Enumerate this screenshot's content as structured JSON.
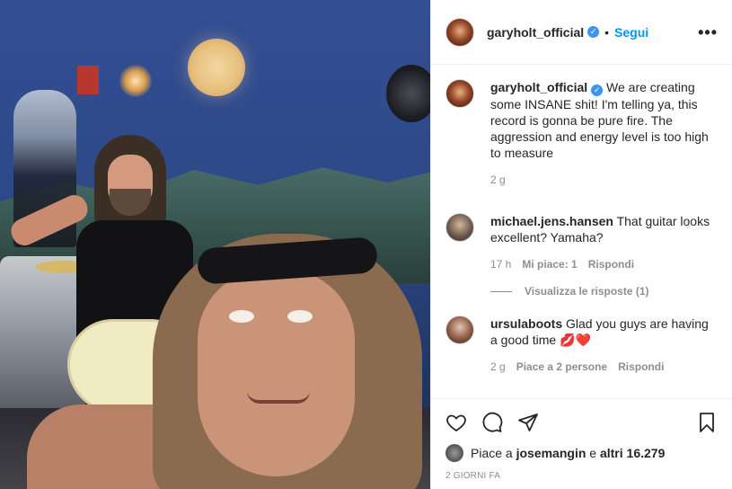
{
  "header": {
    "username": "garyholt_official",
    "separator": "•",
    "follow_label": "Segui",
    "more_icon": "more-options-icon"
  },
  "caption": {
    "username": "garyholt_official",
    "text": "We are creating some INSANE shit! I'm telling ya, this record is gonna be pure fire. The aggression and energy level is too high to measure",
    "time": "2 g"
  },
  "comments": [
    {
      "username": "michael.jens.hansen",
      "text": "That guitar looks excellent? Yamaha?",
      "time": "17 h",
      "likes": "Mi piace: 1",
      "reply_label": "Rispondi",
      "view_replies": "Visualizza le risposte (1)"
    },
    {
      "username": "ursulaboots",
      "text": "Glad you guys are having a good time",
      "emoji": "💋❤️",
      "time": "2 g",
      "likes": "Piace a 2 persone",
      "reply_label": "Rispondi"
    }
  ],
  "likes": {
    "prefix": "Piace a",
    "user": "josemangin",
    "middle": "e",
    "others": "altri 16.279"
  },
  "timestamp": "2 GIORNI FA",
  "colors": {
    "accent": "#0095f6",
    "verified": "#3897f0",
    "muted": "#8e8e8e",
    "text": "#262626"
  }
}
